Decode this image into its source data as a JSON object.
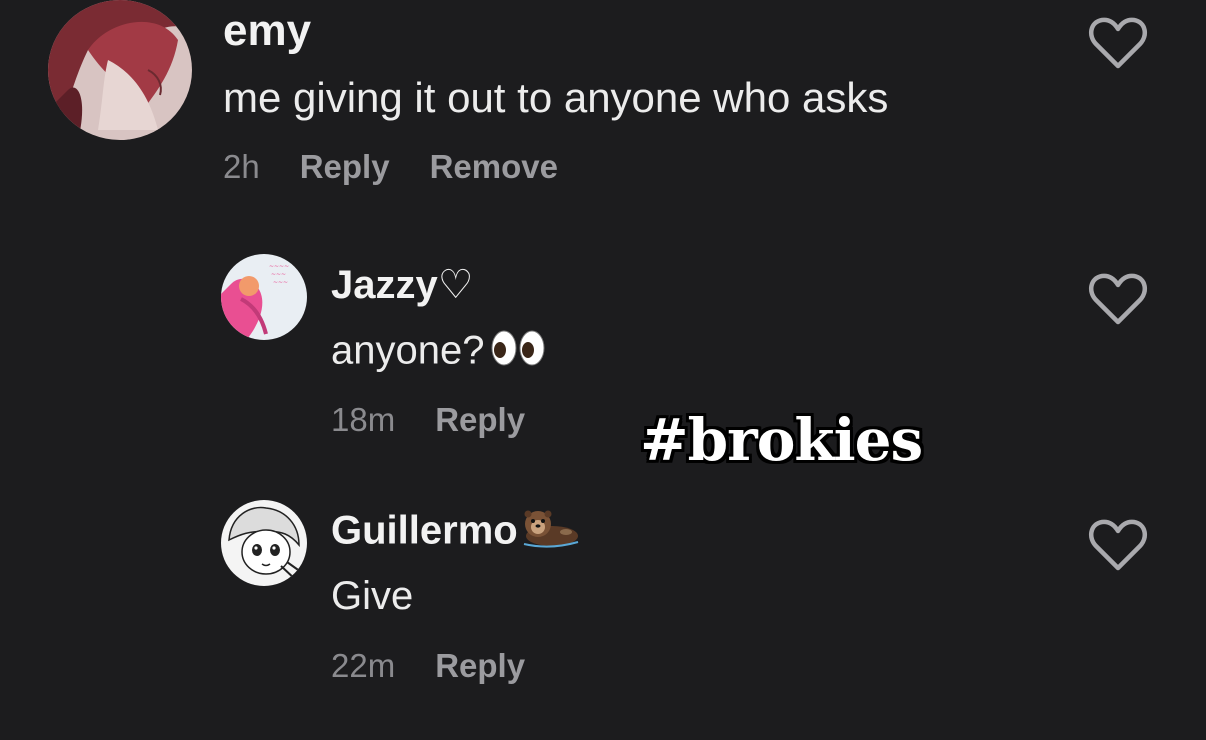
{
  "comments": [
    {
      "username": "emy",
      "text": "me giving it out to anyone who asks",
      "time": "2h",
      "reply_label": "Reply",
      "remove_label": "Remove",
      "avatar": "anime-red-hair-avatar"
    },
    {
      "username": "Jazzy",
      "username_suffix": "♡",
      "text": "anyone?",
      "text_emoji": "eyes-emoji",
      "time": "18m",
      "reply_label": "Reply",
      "avatar": "pink-illustration-avatar"
    },
    {
      "username": "Guillermo",
      "username_emoji": "otter-emoji",
      "text": "Give",
      "time": "22m",
      "reply_label": "Reply",
      "avatar": "manga-girl-avatar"
    }
  ],
  "overlay": {
    "hashtag": "#brokies"
  },
  "colors": {
    "background": "#1c1c1e",
    "text": "#ececec",
    "muted": "#8a8a8e",
    "heart_outline": "#a9a9ad"
  }
}
